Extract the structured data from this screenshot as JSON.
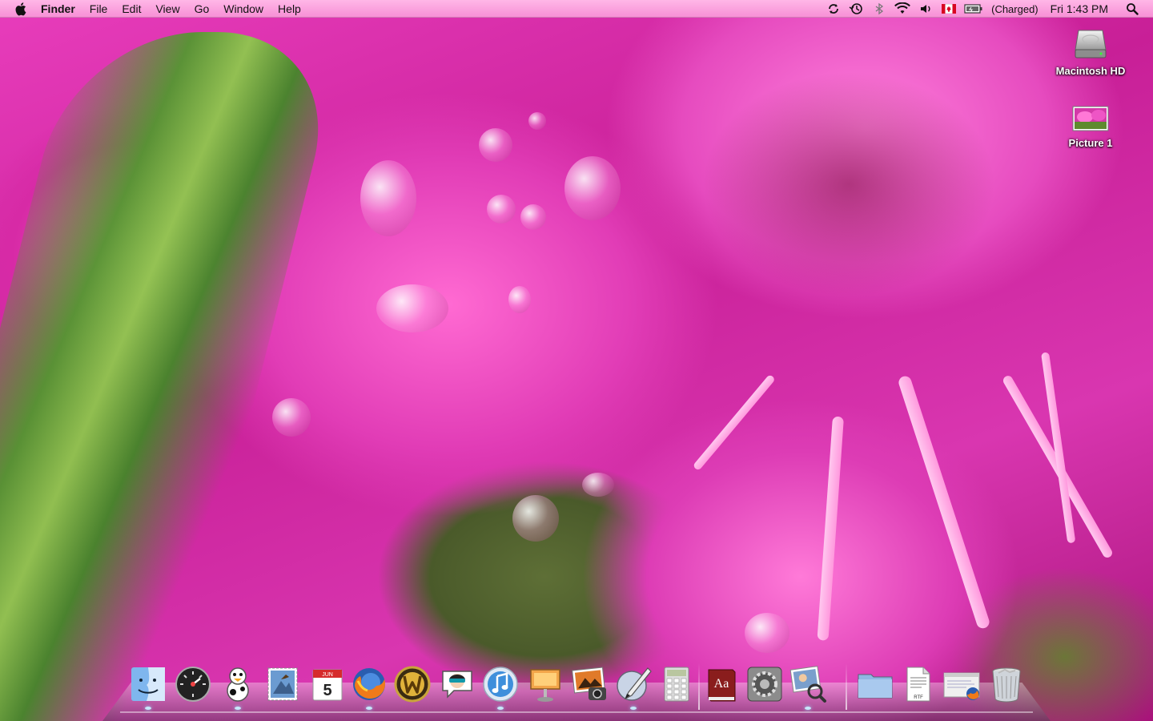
{
  "menubar": {
    "app_name": "Finder",
    "menus": [
      "File",
      "Edit",
      "View",
      "Go",
      "Window",
      "Help"
    ],
    "status": {
      "battery_text": "(Charged)",
      "clock": "Fri 1:43 PM",
      "icons": [
        "sync-icon",
        "time-machine-icon",
        "bluetooth-icon",
        "wifi-icon",
        "volume-icon",
        "canada-flag-icon",
        "battery-icon",
        "spotlight-icon"
      ]
    }
  },
  "desktop": {
    "icons": [
      {
        "label": "Macintosh HD",
        "icon": "hard-drive-icon"
      },
      {
        "label": "Picture 1",
        "icon": "picture-file-icon"
      }
    ]
  },
  "dock": {
    "items": [
      {
        "name": "finder",
        "running": true
      },
      {
        "name": "dashboard",
        "running": false
      },
      {
        "name": "adium",
        "running": true
      },
      {
        "name": "mail",
        "running": false
      },
      {
        "name": "ical",
        "running": false,
        "month": "JUN",
        "day": "5"
      },
      {
        "name": "firefox",
        "running": true
      },
      {
        "name": "world-of-warcraft",
        "running": false
      },
      {
        "name": "ichat-avatar",
        "running": false
      },
      {
        "name": "itunes",
        "running": true
      },
      {
        "name": "keynote",
        "running": false
      },
      {
        "name": "iphoto",
        "running": false
      },
      {
        "name": "script-editor",
        "running": true
      },
      {
        "name": "calculator",
        "running": false
      },
      {
        "name": "dictionary",
        "running": false,
        "glyph": "Aa"
      },
      {
        "name": "system-preferences",
        "running": false
      },
      {
        "name": "preview",
        "running": true
      },
      {
        "name": "documents-folder",
        "running": false
      },
      {
        "name": "rtf-document",
        "running": false,
        "label": "RTF"
      },
      {
        "name": "firefox-window",
        "running": false
      },
      {
        "name": "trash",
        "running": false
      }
    ]
  },
  "colors": {
    "menubar_top": "#ffb7e7",
    "menubar_bottom": "#f790d6",
    "wallpaper_pink": "#e13cb6",
    "dock_indicator": "#c8f0ff"
  }
}
